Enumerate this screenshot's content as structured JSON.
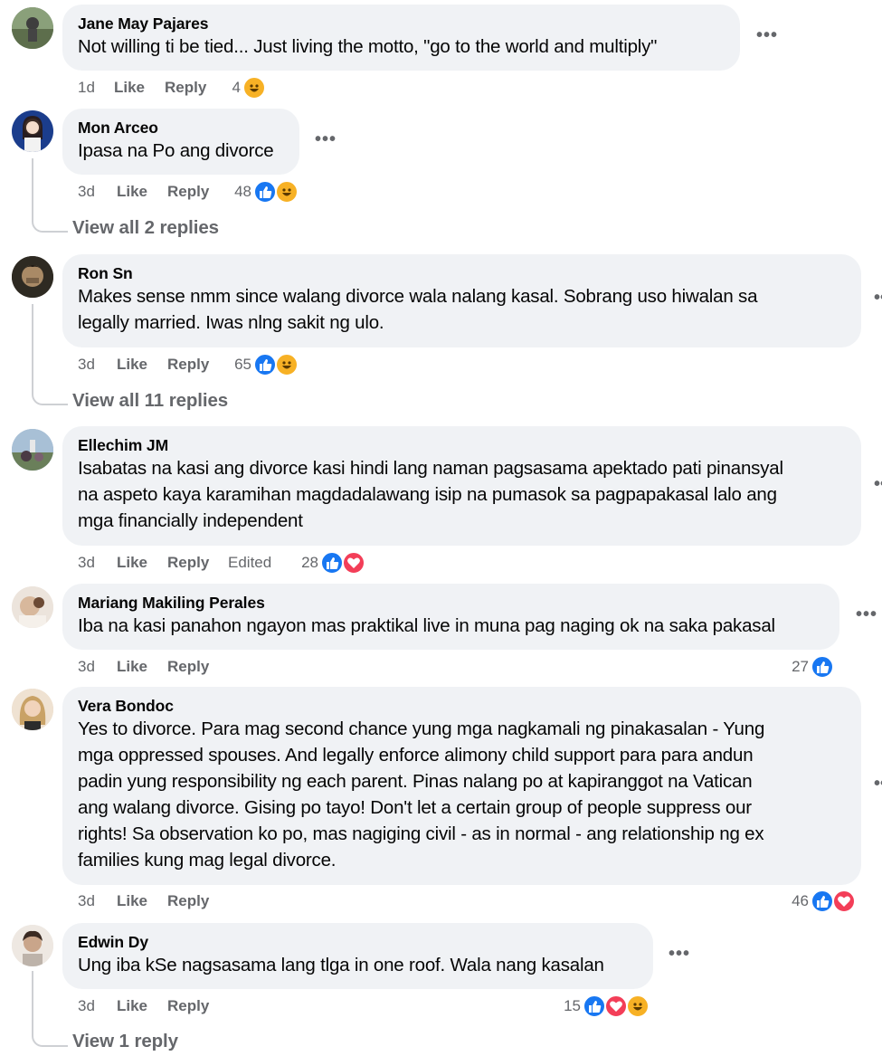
{
  "comments": [
    {
      "author": "Jane May Pajares",
      "text": "Not willing ti be tied... Just living the motto, \"go to the world and multiply\"",
      "time": "1d",
      "like": "Like",
      "reply": "Reply",
      "reaction_count": "4",
      "reactions": [
        "haha-icon"
      ],
      "more": "•••"
    },
    {
      "author": "Mon Arceo",
      "text": "Ipasa na Po ang divorce",
      "time": "3d",
      "like": "Like",
      "reply": "Reply",
      "reaction_count": "48",
      "reactions": [
        "like-icon",
        "haha-icon"
      ],
      "more": "•••",
      "view_replies": "View all 2 replies"
    },
    {
      "author": "Ron Sn",
      "text": "Makes sense nmm since walang divorce wala nalang kasal. Sobrang uso hiwalan sa\nlegally married. Iwas nlng sakit ng ulo.",
      "time": "3d",
      "like": "Like",
      "reply": "Reply",
      "reaction_count": "65",
      "reactions": [
        "like-icon",
        "haha-icon"
      ],
      "view_replies": "View all 11 replies"
    },
    {
      "author": "Ellechim JM",
      "text": "Isabatas na kasi ang divorce kasi hindi lang naman pagsasama apektado pati pinansyal\nna aspeto kaya karamihan magdadalawang isip na pumasok sa pagpapakasal lalo ang\nmga financially independent",
      "time": "3d",
      "like": "Like",
      "reply": "Reply",
      "edited": "Edited",
      "reaction_count": "28",
      "reactions": [
        "like-icon",
        "love-icon"
      ]
    },
    {
      "author": "Mariang Makiling Perales",
      "text": "Iba na kasi panahon ngayon mas praktikal live in muna pag naging ok na saka pakasal",
      "time": "3d",
      "like": "Like",
      "reply": "Reply",
      "reaction_count": "27",
      "reactions": [
        "like-icon"
      ],
      "more": "•••"
    },
    {
      "author": "Vera Bondoc",
      "text": "Yes to divorce. Para mag second chance yung mga nagkamali ng pinakasalan - Yung\nmga oppressed spouses. And legally enforce alimony child support para para andun\npadin yung responsibility ng each parent. Pinas nalang po at kapiranggot na Vatican\nang walang divorce. Gising po tayo! Don't let a certain group of people suppress our\nrights! Sa observation ko po, mas nagiging civil - as in normal - ang relationship ng ex\nfamilies kung mag legal divorce.",
      "time": "3d",
      "like": "Like",
      "reply": "Reply",
      "reaction_count": "46",
      "reactions": [
        "like-icon",
        "love-icon"
      ]
    },
    {
      "author": "Edwin Dy",
      "text": "Ung iba kSe nagsasama lang tlga in one roof. Wala nang kasalan",
      "time": "3d",
      "like": "Like",
      "reply": "Reply",
      "reaction_count": "15",
      "reactions": [
        "like-icon",
        "love-icon",
        "haha-icon"
      ],
      "more": "•••",
      "view_replies": "View 1 reply"
    }
  ],
  "colors": {
    "bubble": "#f0f2f5",
    "meta": "#65676b",
    "like": "#1877f2",
    "love": "#f33e58",
    "haha": "#f7b125"
  }
}
